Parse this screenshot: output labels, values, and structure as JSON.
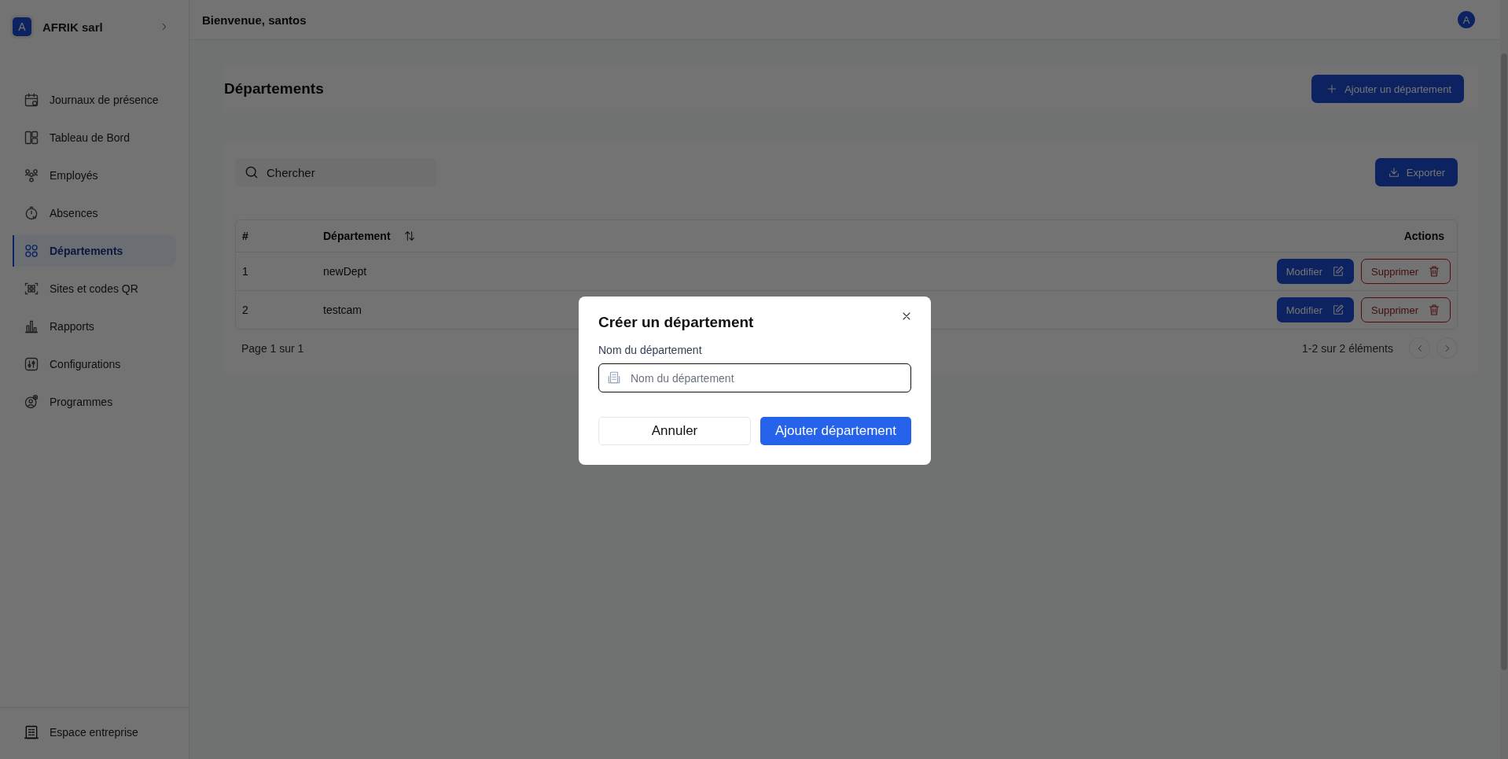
{
  "header": {
    "title": "Bienvenue, santos",
    "avatar": "A"
  },
  "sidebar": {
    "company": {
      "initial": "A",
      "name": "AFRIK sarl"
    },
    "items": [
      {
        "label": "Journaux de présence",
        "selected": false
      },
      {
        "label": "Tableau de Bord",
        "selected": false
      },
      {
        "label": "Employés",
        "selected": false
      },
      {
        "label": "Absences",
        "selected": false
      },
      {
        "label": "Départements",
        "selected": true
      },
      {
        "label": "Sites et codes QR",
        "selected": false
      },
      {
        "label": "Rapports",
        "selected": false
      },
      {
        "label": "Configurations",
        "selected": false
      },
      {
        "label": "Programmes",
        "selected": false
      }
    ],
    "footer": {
      "label": "Espace entreprise"
    }
  },
  "page": {
    "title": "Départements",
    "add_button": "Ajouter un département"
  },
  "toolbar": {
    "search": {
      "placeholder": "Chercher"
    },
    "export_button": "Exporter"
  },
  "table": {
    "columns": [
      {
        "label": "#",
        "sortable": false
      },
      {
        "label": "Département",
        "sortable": true
      },
      {
        "label": "Actions",
        "sortable": false
      }
    ],
    "rows": [
      {
        "cells": [
          "1",
          "newDept"
        ],
        "actions": [
          "Modifier",
          "Supprimer"
        ]
      },
      {
        "cells": [
          "2",
          "testcam"
        ],
        "actions": [
          "Modifier",
          "Supprimer"
        ]
      }
    ]
  },
  "pagination": {
    "page_info": "Page 1 sur 1",
    "range": "1-2 sur 2 éléments"
  },
  "dialog": {
    "title": "Créer un département",
    "field_label": "Nom du département",
    "field": {
      "placeholder": "Nom du département"
    },
    "cancel": "Annuler",
    "submit": "Ajouter département"
  }
}
